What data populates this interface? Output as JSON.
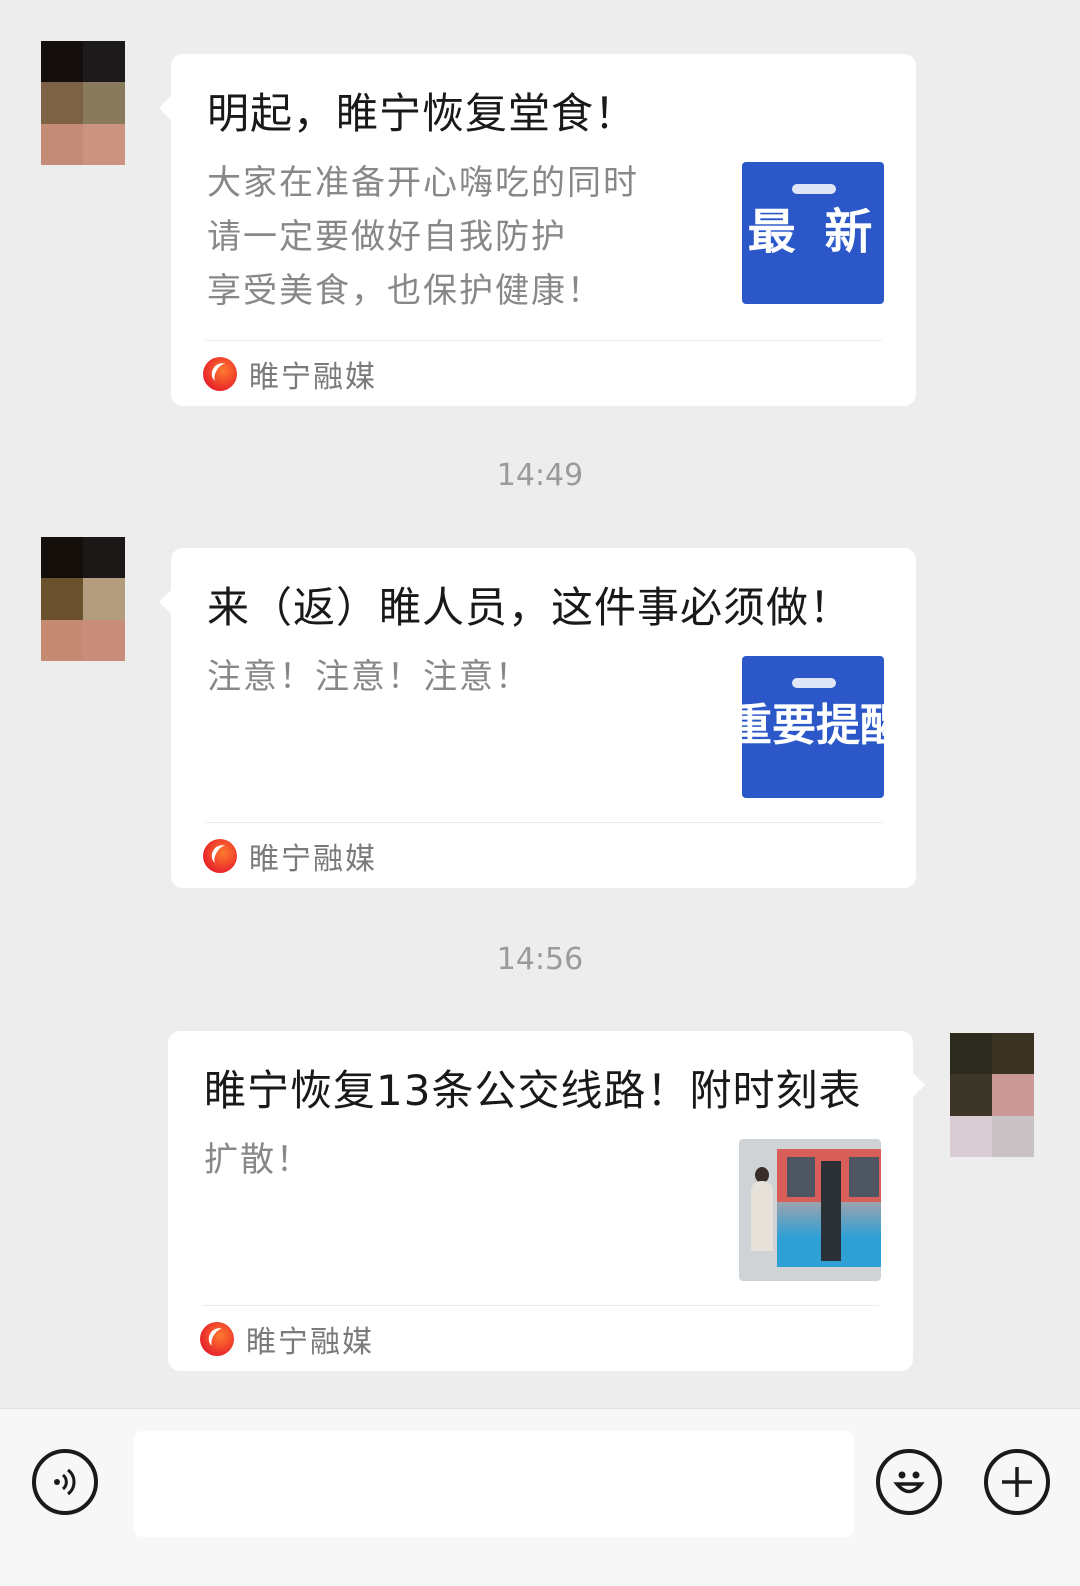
{
  "messages": [
    {
      "title": "明起，睢宁恢复堂食！",
      "desc_lines": [
        "大家在准备开心嗨吃的同时",
        "请一定要做好自我防护",
        "享受美食，也保护健康！"
      ],
      "thumb_text": "最 新",
      "source": "睢宁融媒"
    },
    {
      "title": "来（返）睢人员，这件事必须做！",
      "desc_lines": [
        "注意！注意！注意！"
      ],
      "thumb_text": "重要提醒",
      "source": "睢宁融媒"
    },
    {
      "title": "睢宁恢复13条公交线路！附时刻表",
      "desc_lines": [
        "扩散！"
      ],
      "source": "睢宁融媒"
    }
  ],
  "timestamps": [
    "14:49",
    "14:56"
  ],
  "colors": {
    "background": "#ededed",
    "card": "#ffffff",
    "thumb_blue": "#2b57c9",
    "source_logo": "#e8262b"
  },
  "icons": {
    "voice": "voice-icon",
    "emoji": "emoji-icon",
    "plus": "plus-icon"
  }
}
